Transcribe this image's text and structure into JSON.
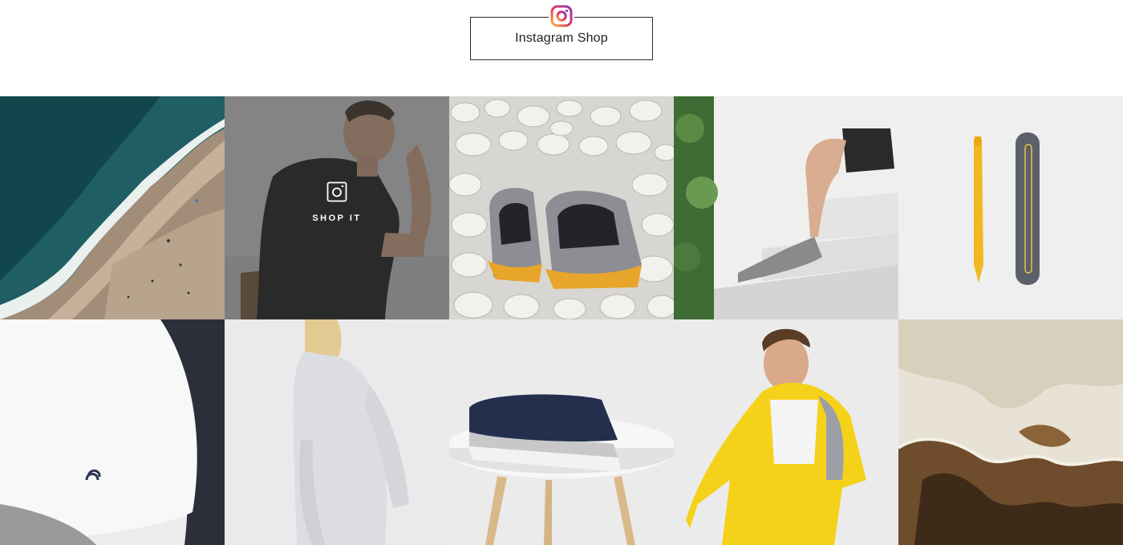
{
  "header": {
    "title": "Instagram Shop",
    "logo_icon": "instagram-gradient-icon"
  },
  "overlay": {
    "label": "SHOP IT",
    "icon": "instagram-outline-icon"
  },
  "colors": {
    "overlay": "#3c3c3c",
    "accent_yellow": "#f5c518",
    "navy": "#2a3550"
  },
  "tiles": [
    {
      "subject": "aerial-ocean-beach"
    },
    {
      "subject": "man-black-tshirt",
      "hover": true
    },
    {
      "subject": "grey-slippers-on-pebbles"
    },
    {
      "subject": "legs-on-stairs-slippers"
    },
    {
      "subject": "yellow-pen-and-case"
    },
    {
      "subject": "white-tshirt-closeup"
    },
    {
      "subject": "woman-grey-jacket"
    },
    {
      "subject": "folded-shirts-on-stool"
    },
    {
      "subject": "man-yellow-jacket"
    },
    {
      "subject": "salt-flat-texture"
    }
  ]
}
